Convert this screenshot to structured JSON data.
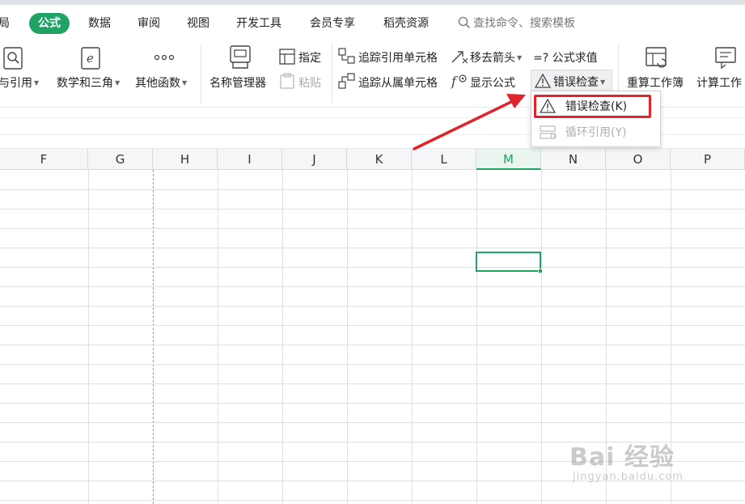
{
  "menu": {
    "tabs": [
      {
        "label": "局",
        "active": false
      },
      {
        "label": "公式",
        "active": true
      },
      {
        "label": "数据",
        "active": false
      },
      {
        "label": "审阅",
        "active": false
      },
      {
        "label": "视图",
        "active": false
      },
      {
        "label": "开发工具",
        "active": false
      },
      {
        "label": "会员专享",
        "active": false
      },
      {
        "label": "稻壳资源",
        "active": false
      }
    ],
    "search_placeholder": "查找命令、搜索模板"
  },
  "ribbon": {
    "lookup_label": "与引用",
    "math_label": "数学和三角",
    "other_label": "其他函数",
    "name_manager_label": "名称管理器",
    "define_label": "指定",
    "paste_label": "粘贴",
    "trace_precedents_label": "追踪引用单元格",
    "trace_dependents_label": "追踪从属单元格",
    "remove_arrows_label": "移去箭头",
    "show_formulas_label": "显示公式",
    "evaluate_label": "公式求值",
    "evaluate_prefix": "=?",
    "error_check_label": "错误检查",
    "recalc_workbook_label": "重算工作簿",
    "calc_sheet_label": "计算工作"
  },
  "dropdown": {
    "items": [
      {
        "label": "错误检查(K)",
        "enabled": true
      },
      {
        "label": "循环引用(Y)",
        "enabled": false
      }
    ]
  },
  "sheet": {
    "columns": [
      "F",
      "G",
      "H",
      "I",
      "J",
      "K",
      "L",
      "M",
      "N",
      "O",
      "P"
    ],
    "selected_column": "M",
    "active_cell": "M5"
  },
  "watermark": {
    "brand": "Bai 经验",
    "url": "jingyan.baidu.com"
  },
  "colors": {
    "accent": "#21a366",
    "highlight": "#e0242b"
  }
}
